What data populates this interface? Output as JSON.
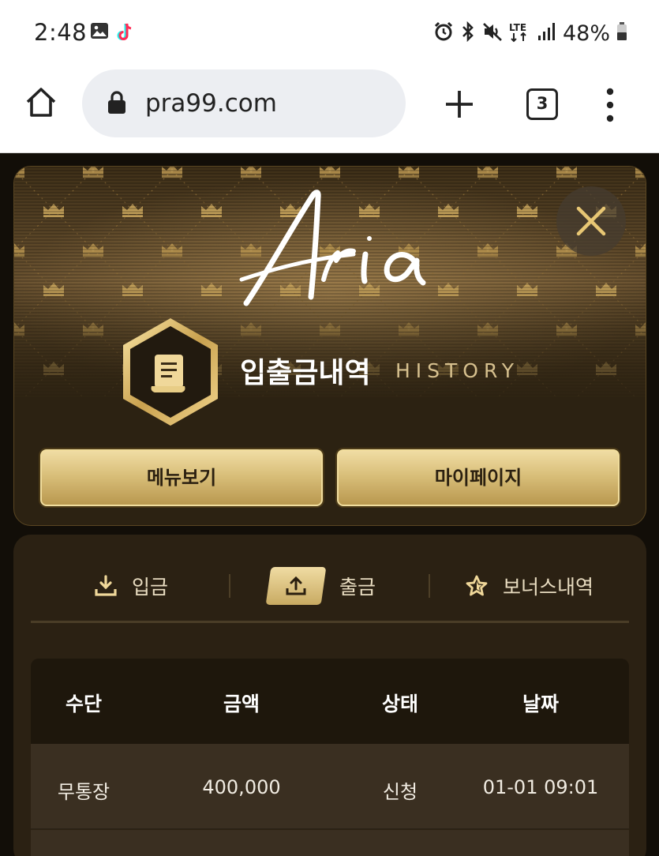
{
  "status_bar": {
    "time": "2:48",
    "battery": "48%",
    "left_icons": [
      "image-icon",
      "tiktok-icon"
    ],
    "right_icons": [
      "alarm-icon",
      "bluetooth-icon",
      "mute-icon",
      "lte-icon",
      "signal-icon",
      "battery-icon"
    ]
  },
  "browser": {
    "url": "pra99.com",
    "tab_count": "3"
  },
  "header": {
    "logo_text": "Aria",
    "title_ko": "입출금내역",
    "title_en": "HISTORY",
    "menu_button": "메뉴보기",
    "mypage_button": "마이페이지"
  },
  "history": {
    "tabs": [
      {
        "label": "입금",
        "icon": "download-icon",
        "active": false
      },
      {
        "label": "출금",
        "icon": "upload-icon",
        "active": true
      },
      {
        "label": "보너스내역",
        "icon": "star-icon",
        "active": false
      }
    ],
    "columns": [
      "수단",
      "금액",
      "상태",
      "날짜"
    ],
    "rows": [
      {
        "method": "무통장",
        "amount": "400,000",
        "status": "신청",
        "date": "01-01 09:01"
      }
    ]
  },
  "colors": {
    "gold": "#d9bf7a",
    "panel": "#2b2113",
    "page_bg": "#120e08"
  }
}
